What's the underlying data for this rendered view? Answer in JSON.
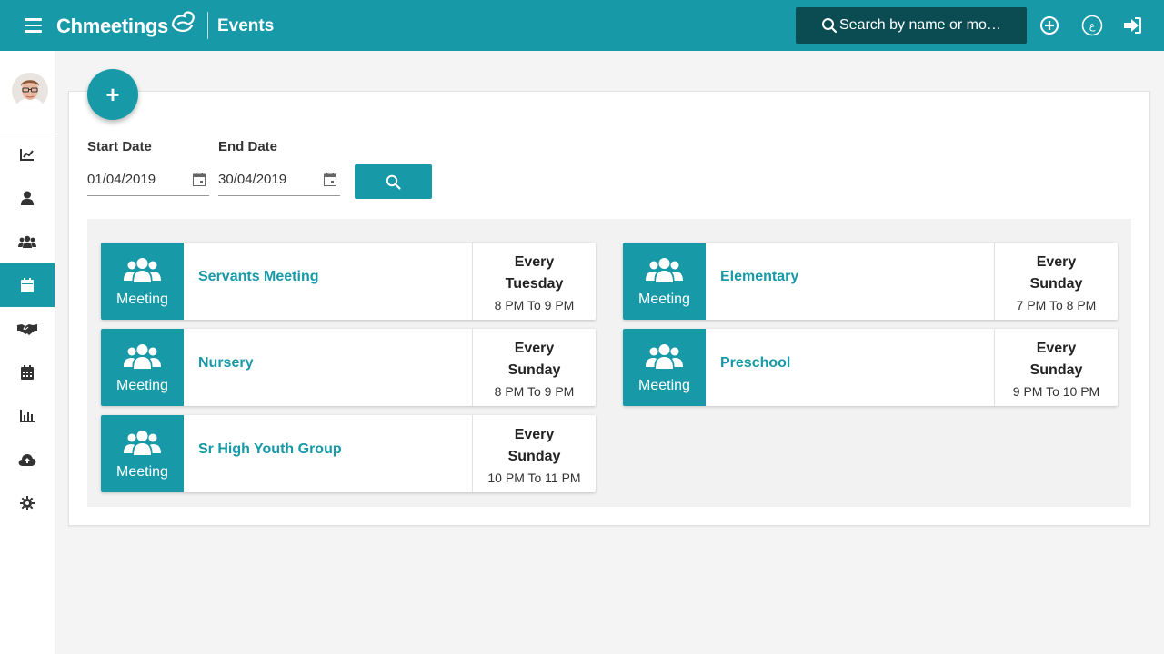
{
  "app": {
    "brand": "Chmeetings",
    "section": "Events"
  },
  "search": {
    "placeholder": "Search by name or mo…"
  },
  "filters": {
    "start_label": "Start Date",
    "start_value": "01/04/2019",
    "end_label": "End Date",
    "end_value": "30/04/2019"
  },
  "fab": {
    "label": "+"
  },
  "colors": {
    "primary": "#1799a7",
    "search_bg": "#0b4c53",
    "link": "#1799a7"
  },
  "sidebar": {
    "items": [
      {
        "icon": "chart-line-icon"
      },
      {
        "icon": "user-icon"
      },
      {
        "icon": "users-icon"
      },
      {
        "icon": "calendar-icon",
        "active": true
      },
      {
        "icon": "handshake-icon"
      },
      {
        "icon": "calendar-grid-icon"
      },
      {
        "icon": "bar-chart-icon"
      },
      {
        "icon": "cloud-upload-icon"
      },
      {
        "icon": "gear-icon"
      }
    ]
  },
  "events": [
    {
      "type": "Meeting",
      "name": "Servants Meeting",
      "every": "Every",
      "day": "Tuesday",
      "time": "8 PM To 9 PM"
    },
    {
      "type": "Meeting",
      "name": "Elementary",
      "every": "Every",
      "day": "Sunday",
      "time": "7 PM To 8 PM"
    },
    {
      "type": "Meeting",
      "name": "Nursery",
      "every": "Every",
      "day": "Sunday",
      "time": "8 PM To 9 PM"
    },
    {
      "type": "Meeting",
      "name": "Preschool",
      "every": "Every",
      "day": "Sunday",
      "time": "9 PM To 10 PM"
    },
    {
      "type": "Meeting",
      "name": "Sr High Youth Group",
      "every": "Every",
      "day": "Sunday",
      "time": "10 PM To 11 PM"
    }
  ]
}
